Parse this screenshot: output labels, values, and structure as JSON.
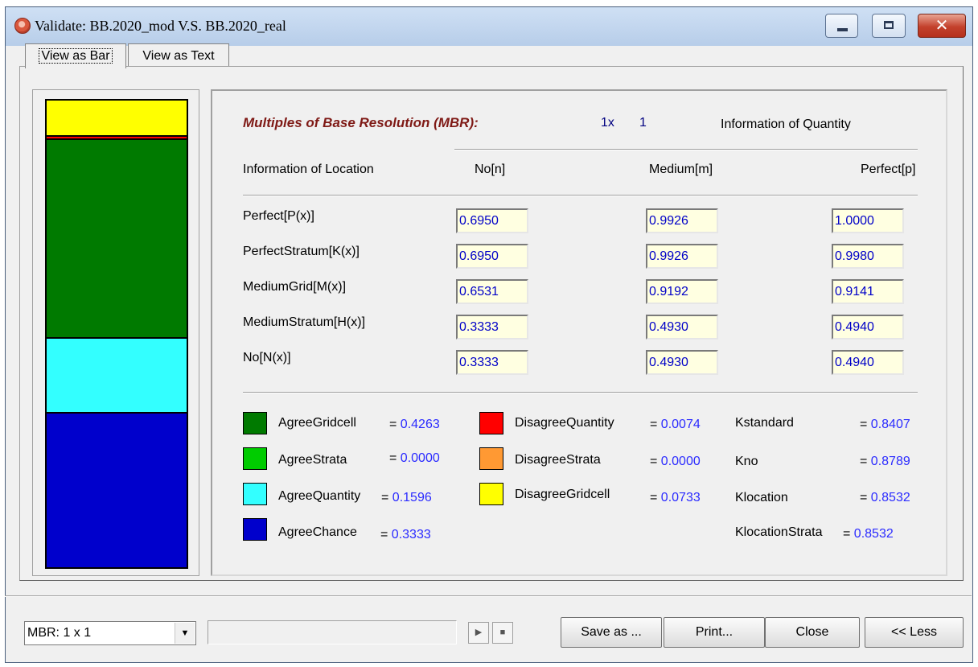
{
  "window": {
    "title": "Validate: BB.2020_mod V.S. BB.2020_real"
  },
  "tabs": [
    "View as Bar",
    "View as Text"
  ],
  "bar_segments": [
    {
      "name": "DisagreeGridcell",
      "color": "#ffff00",
      "fraction": 0.0733
    },
    {
      "name": "DisagreeStrata",
      "color": "#ff9933",
      "fraction": 0.0
    },
    {
      "name": "DisagreeQuantity",
      "color": "#ff0000",
      "fraction": 0.0074
    },
    {
      "name": "AgreeGridcell",
      "color": "#007a00",
      "fraction": 0.4263
    },
    {
      "name": "AgreeStrata",
      "color": "#00cc00",
      "fraction": 0.0
    },
    {
      "name": "AgreeQuantity",
      "color": "#33ffff",
      "fraction": 0.1596
    },
    {
      "name": "AgreeChance",
      "color": "#0000cc",
      "fraction": 0.3333
    }
  ],
  "header": {
    "mbr_title": "Multiples of Base Resolution (MBR):",
    "mbr_factor": "1x",
    "mbr_value": "1",
    "info_quantity": "Information of Quantity",
    "info_location": "Information of Location",
    "col_no": "No[n]",
    "col_medium": "Medium[m]",
    "col_perfect": "Perfect[p]"
  },
  "matrix": {
    "rows": [
      {
        "label": "Perfect[P(x)]",
        "values": [
          "0.6950",
          "0.9926",
          "1.0000"
        ]
      },
      {
        "label": "PerfectStratum[K(x)]",
        "values": [
          "0.6950",
          "0.9926",
          "0.9980"
        ]
      },
      {
        "label": "MediumGrid[M(x)]",
        "values": [
          "0.6531",
          "0.9192",
          "0.9141"
        ]
      },
      {
        "label": "MediumStratum[H(x)]",
        "values": [
          "0.3333",
          "0.4930",
          "0.4940"
        ]
      },
      {
        "label": "No[N(x)]",
        "values": [
          "0.3333",
          "0.4930",
          "0.4940"
        ]
      }
    ]
  },
  "legend": {
    "agree": [
      {
        "label": "AgreeGridcell",
        "color": "#007a00",
        "value": "0.4263"
      },
      {
        "label": "AgreeStrata",
        "color": "#00cc00",
        "value": "0.0000"
      },
      {
        "label": "AgreeQuantity",
        "color": "#33ffff",
        "value": "0.1596"
      },
      {
        "label": "AgreeChance",
        "color": "#0000cc",
        "value": "0.3333"
      }
    ],
    "disagree": [
      {
        "label": "DisagreeQuantity",
        "color": "#ff0000",
        "value": "0.0074"
      },
      {
        "label": "DisagreeStrata",
        "color": "#ff9933",
        "value": "0.0000"
      },
      {
        "label": "DisagreeGridcell",
        "color": "#ffff00",
        "value": "0.0733"
      }
    ],
    "kappa": [
      {
        "label": "Kstandard",
        "value": "0.8407"
      },
      {
        "label": "Kno",
        "value": "0.8789"
      },
      {
        "label": "Klocation",
        "value": "0.8532"
      },
      {
        "label": "KlocationStrata",
        "value": "0.8532"
      }
    ],
    "eq": "="
  },
  "footer": {
    "mbr_select": "MBR: 1 x 1",
    "save_label": "Save as ...",
    "print_label": "Print...",
    "close_label": "Close",
    "less_label": "<< Less"
  }
}
